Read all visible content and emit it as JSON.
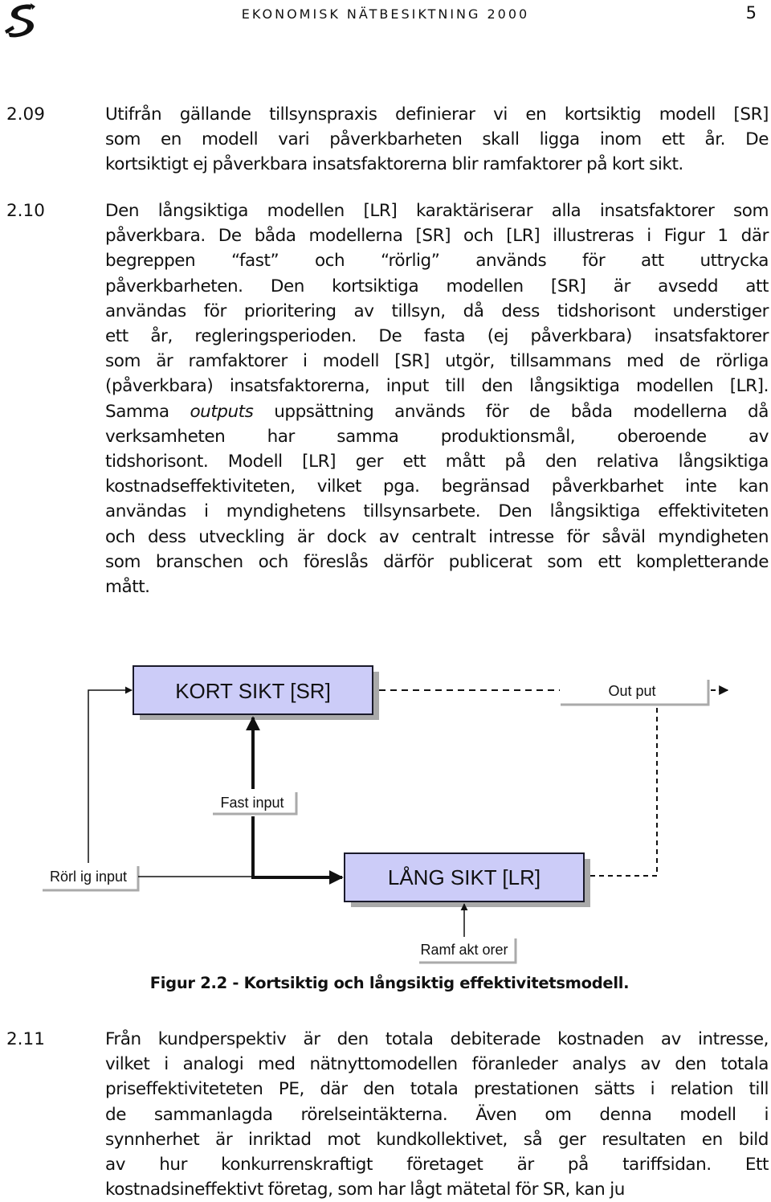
{
  "header": {
    "logo_icon": "stylized-s-logo",
    "running_title": "EKONOMISK NÄTBESIKTNING 2000",
    "page_number": "5"
  },
  "paragraphs": [
    {
      "number": "2.09",
      "lines": [
        "Utifrån gällande tillsynspraxis definierar vi en kortsiktig modell [SR]",
        "som en modell vari påverkbarheten skall ligga inom ett år. De",
        "kortsiktigt ej påverkbara insatsfaktorerna blir ramfaktorer på kort sikt."
      ]
    },
    {
      "number": "2.10",
      "lines": [
        "Den långsiktiga modellen [LR] karaktäriserar alla insatsfaktorer som",
        "påverkbara. De båda modellerna [SR] och [LR] illustreras i Figur 1 där",
        "begreppen “fast” och “rörlig” används för att uttrycka",
        "påverkbarheten. Den kortsiktiga modellen [SR] är avsedd att",
        "användas för prioritering av tillsyn, då dess tidshorisont understiger",
        "ett år, regleringsperioden. De fasta (ej påverkbara) insatsfaktorer",
        "som är ramfaktorer i modell [SR] utgör, tillsammans med de rörliga",
        "(påverkbara) insatsfaktorerna, input till den långsiktiga modellen [LR].",
        "Samma |outputs| uppsättning används för de båda modellerna då",
        "verksamheten har samma produktionsmål, oberoende av",
        "tidshorisont. Modell [LR] ger ett mått på den relativa långsiktiga",
        "kostnadseffektiviteten, vilket pga. begränsad påverkbarhet inte kan",
        "användas i myndighetens tillsynsarbete. Den långsiktiga effektiviteten",
        "och dess utveckling är dock av centralt intresse för såväl myndigheten",
        "som branschen och föreslås därför publicerat som ett kompletterande",
        "mått."
      ],
      "italic_word": "outputs"
    },
    {
      "number": "2.11",
      "lines": [
        "Från kundperspektiv är den totala debiterade kostnaden av intresse,",
        "vilket i analogi med nätnyttomodellen föranleder analys av den totala",
        "priseffektiviteteten PE, där den totala prestationen sätts i relation till",
        "de sammanlagda rörelseintäkterna. Även om denna modell i",
        "synnherhet är inriktad mot kundkollektivet, så ger resultaten en bild",
        "av hur konkurrenskraftigt företaget är på tariffsidan. Ett",
        "kostnadsineffektivt företag, som har lågt mätetal för SR, kan ju"
      ]
    }
  ],
  "figure": {
    "box_short": "KORT SIKT [SR]",
    "box_long": "LÅNG SIKT [LR]",
    "label_output": "Out put",
    "label_fast_input": "Fast input",
    "label_variable_input": "Rörl ig input",
    "label_frame_factors": "Ramf akt orer",
    "box_fill": "#ccccf8",
    "caption": "Figur 2.2 - Kortsiktig och långsiktig effektivitetsmodell."
  }
}
